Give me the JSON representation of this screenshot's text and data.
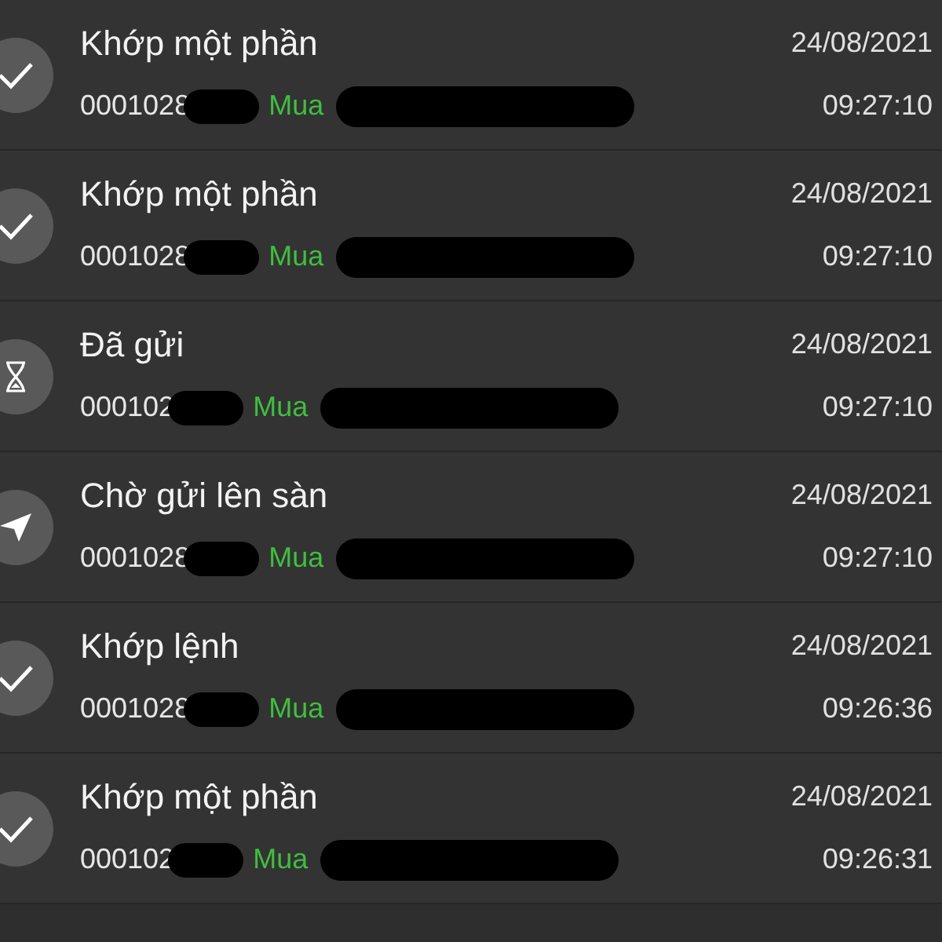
{
  "orders": [
    {
      "kind": "matched",
      "status": "Khớp một phần",
      "order_no": "0001028",
      "side": "Mua",
      "date": "24/08/2021",
      "time": "09:27:10"
    },
    {
      "kind": "matched",
      "status": "Khớp một phần",
      "order_no": "0001028",
      "side": "Mua",
      "date": "24/08/2021",
      "time": "09:27:10"
    },
    {
      "kind": "sent",
      "status": "Đã gửi",
      "order_no": "000102",
      "side": "Mua",
      "date": "24/08/2021",
      "time": "09:27:10"
    },
    {
      "kind": "queued",
      "status": "Chờ gửi lên sàn",
      "order_no": "0001028",
      "side": "Mua",
      "date": "24/08/2021",
      "time": "09:27:10"
    },
    {
      "kind": "matched",
      "status": "Khớp lệnh",
      "order_no": "0001028",
      "side": "Mua",
      "date": "24/08/2021",
      "time": "09:26:36"
    },
    {
      "kind": "matched",
      "status": "Khớp một phần",
      "order_no": "000102",
      "side": "Mua",
      "date": "24/08/2021",
      "time": "09:26:31"
    }
  ]
}
